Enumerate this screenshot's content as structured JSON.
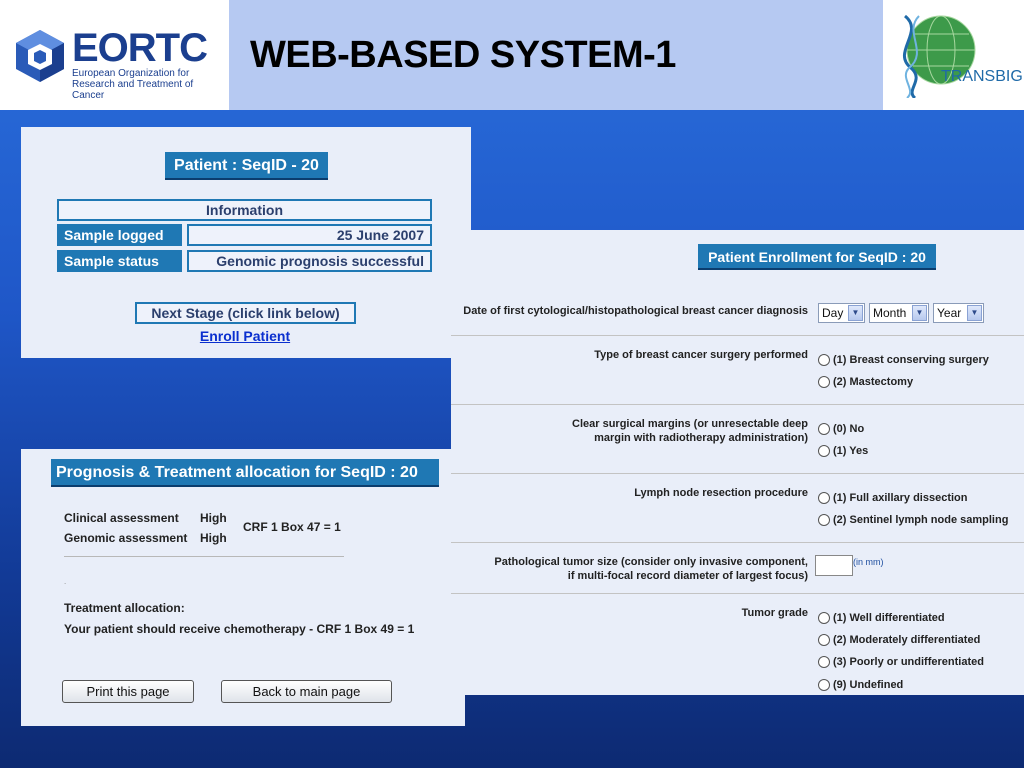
{
  "header": {
    "title": "WEB-BASED SYSTEM-1",
    "eortc_logo_text": "EORTC",
    "eortc_subtitle": "European Organization for Research and Treatment of Cancer",
    "transbig_logo_text": "TRANSBIG"
  },
  "patient_panel": {
    "title": "Patient : SeqID - 20",
    "info_label": "Information",
    "rows": [
      {
        "label": "Sample logged",
        "value": "25 June 2007"
      },
      {
        "label": "Sample status",
        "value": "Genomic prognosis successful"
      }
    ],
    "next_stage": "Next Stage (click link below)",
    "enroll_link": "Enroll Patient"
  },
  "prognosis_panel": {
    "title": "Prognosis & Treatment allocation for SeqID : 20",
    "clinical_label": "Clinical assessment",
    "clinical_value": "High",
    "genomic_label": "Genomic assessment",
    "genomic_value": "High",
    "crf_pre": "CRF",
    "crf_num": "1",
    "crf_post": "Box 47 = 1",
    "treatment_label": "Treatment allocation:",
    "treatment_text_pre": "Your patient should receive chemotherapy - CRF",
    "treatment_crf_num": "1",
    "treatment_text_post": "Box 49 = 1",
    "print_button": "Print this page",
    "back_button": "Back to main page"
  },
  "enrollment_panel": {
    "title": "Patient Enrollment for SeqID : 20",
    "date_question": "Date of first cytological/histopathological breast cancer diagnosis",
    "date_selects": {
      "day": "Day",
      "month": "Month",
      "year": "Year"
    },
    "surgery_question": "Type of breast cancer surgery performed",
    "surgery_options": [
      "(1) Breast conserving surgery",
      "(2) Mastectomy"
    ],
    "margins_question_line1": "Clear surgical margins (or unresectable deep",
    "margins_question_line2": "margin with radiotherapy administration)",
    "margins_options": [
      "(0) No",
      "(1) Yes"
    ],
    "lymph_question": "Lymph node resection procedure",
    "lymph_options": [
      "(1) Full axillary dissection",
      "(2) Sentinel lymph node sampling"
    ],
    "tumor_size_question_line1": "Pathological tumor size (consider only invasive component,",
    "tumor_size_question_line2": "if multi-focal record diameter of largest focus)",
    "tumor_size_unit": "(in mm)",
    "grade_question": "Tumor grade",
    "grade_options": [
      "(1) Well differentiated",
      "(2) Moderately differentiated",
      "(3) Poorly or undifferentiated",
      "(9) Undefined"
    ]
  },
  "colors": {
    "accent": "#1f78b4",
    "link": "#0a2fcf",
    "background_top": "#2a6fdc",
    "background_bottom": "#0d2a72",
    "panel": "#e9eef9"
  }
}
